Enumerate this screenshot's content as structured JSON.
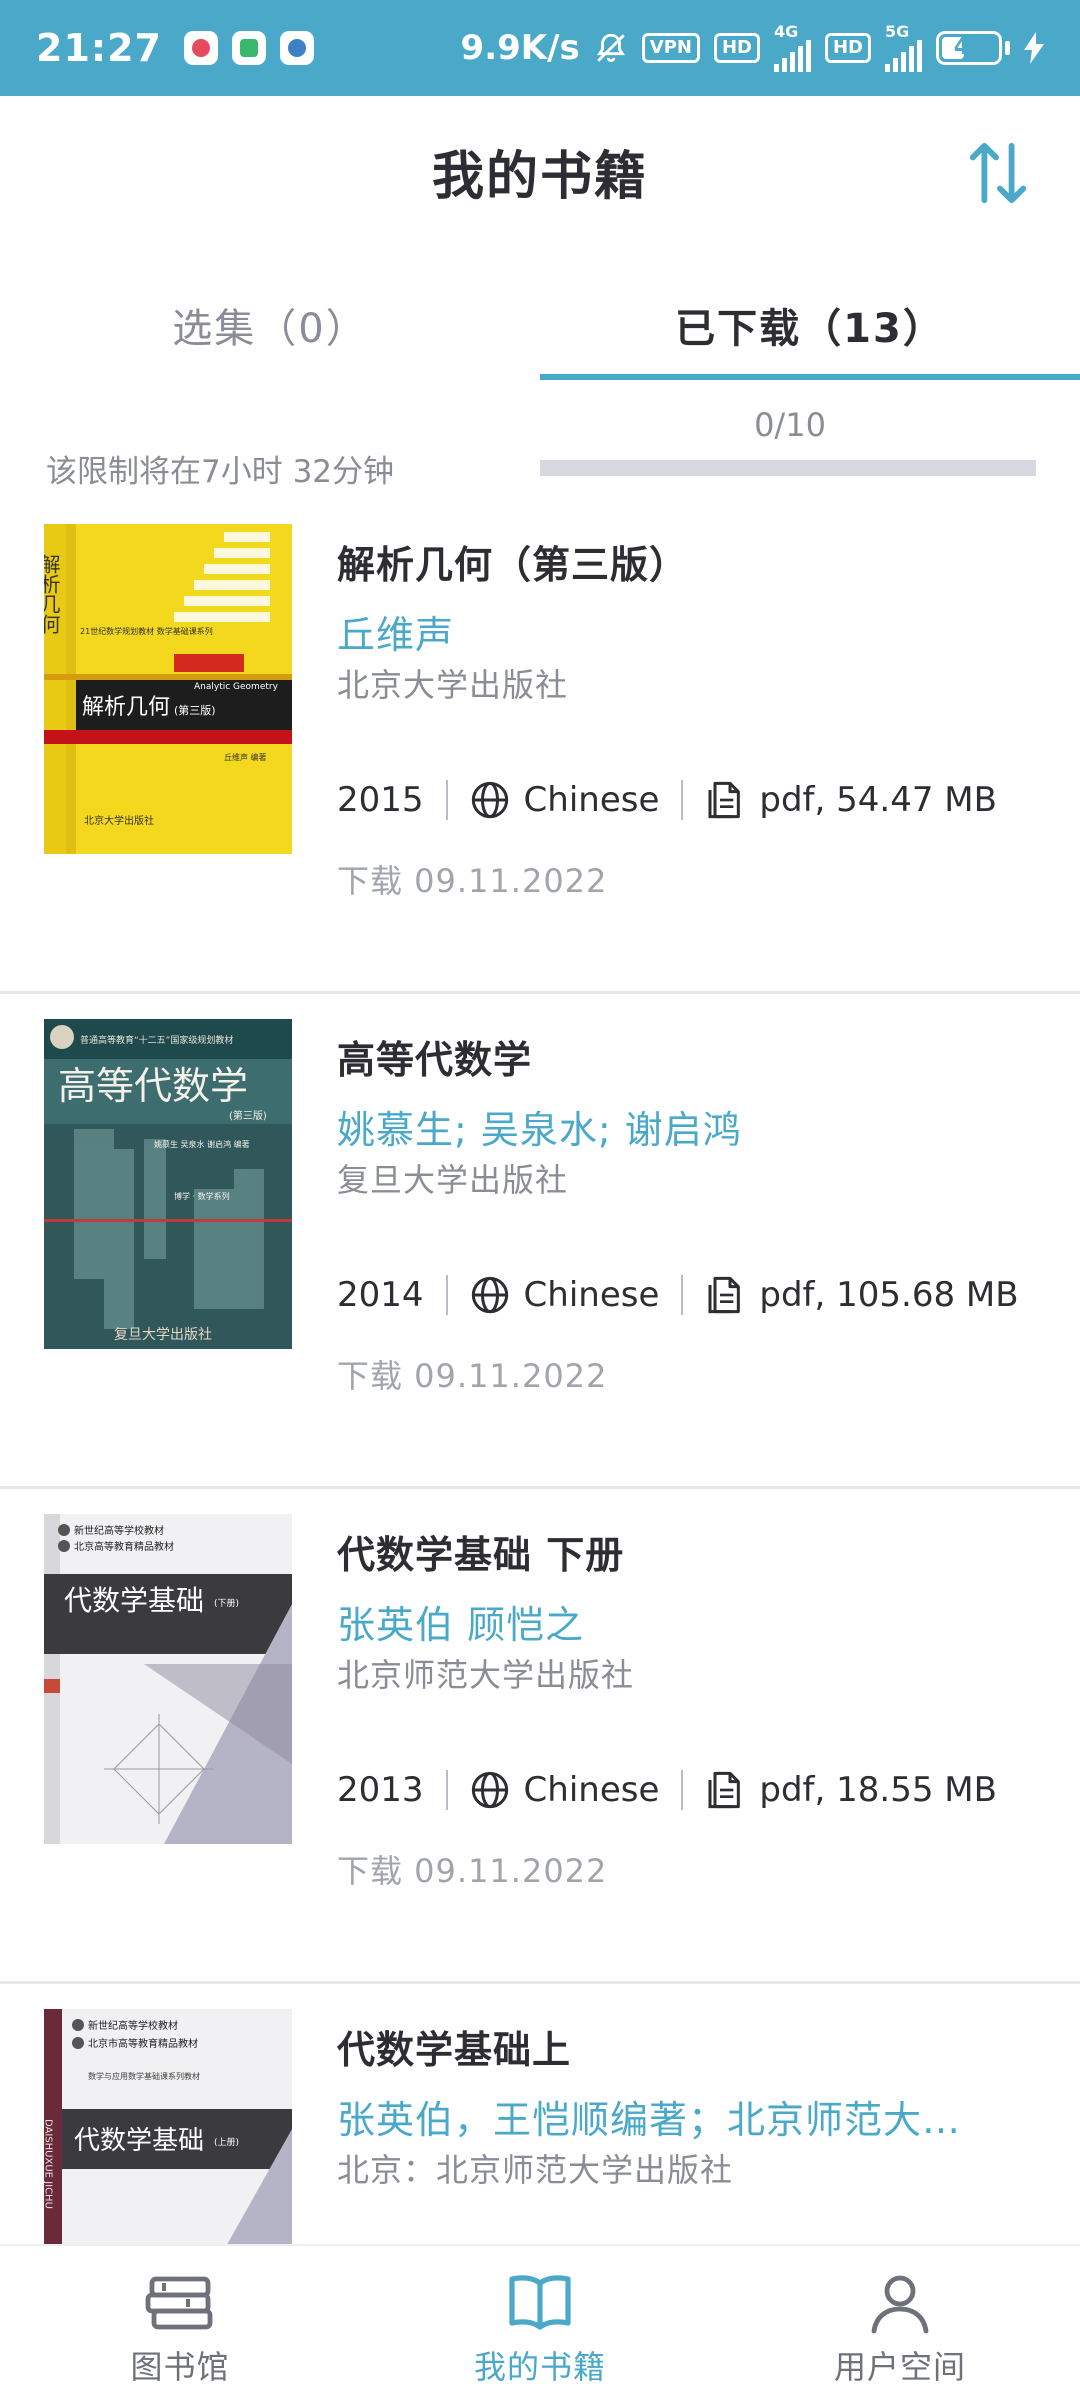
{
  "status_bar": {
    "time": "21:27",
    "speed": "9.9K/s",
    "vpn": "VPN",
    "hd": "HD",
    "net_4g": "4G",
    "net_5g": "5G",
    "battery": "40"
  },
  "header": {
    "title": "我的书籍",
    "sort_icon": "sort-arrows-icon"
  },
  "tabs": [
    {
      "label": "选集（0）",
      "active": false
    },
    {
      "label": "已下载（13）",
      "active": true
    }
  ],
  "quota": {
    "reset_text": "该限制将在7小时 32分钟",
    "count": "0/10",
    "used_fraction": 0
  },
  "books": [
    {
      "title": "解析几何（第三版）",
      "author": "丘维声",
      "publisher": "北京大学出版社",
      "year": "2015",
      "language": "Chinese",
      "file": "pdf, 54.47 MB",
      "downloaded": "下载 09.11.2022",
      "cover": {
        "title": "解析几何",
        "edition": "(第三版)",
        "subtitle": "Analytic Geometry",
        "author": "丘维声 编著",
        "publisher": "北京大学出版社",
        "series": "21世纪数学规划教材 数学基础课系列"
      }
    },
    {
      "title": "高等代数学",
      "author": "姚慕生; 吴泉水; 谢启鸿",
      "publisher": "复旦大学出版社",
      "year": "2014",
      "language": "Chinese",
      "file": "pdf, 105.68 MB",
      "downloaded": "下载 09.11.2022",
      "cover": {
        "title": "高等代数学",
        "edition": "(第三版)",
        "author": "姚慕生 吴泉水 谢启鸿 编著",
        "header": "普通高等教育“十二五”国家级规划教材",
        "series": "博学 · 数学系列",
        "publisher": "复旦大学出版社"
      }
    },
    {
      "title": "代数学基础 下册",
      "author": "张英伯 顾恺之",
      "publisher": "北京师范大学出版社",
      "year": "2013",
      "language": "Chinese",
      "file": "pdf, 18.55 MB",
      "downloaded": "下载 09.11.2022",
      "cover": {
        "title": "代数学基础",
        "edition": "(下册)",
        "line1": "新世纪高等学校教材",
        "line2": "北京高等教育精品教材"
      }
    },
    {
      "title": "代数学基础上",
      "author": "张英伯，王恺顺编著；北京师范大学出版社",
      "publisher": "北京：北京师范大学出版社",
      "year": "",
      "language": "",
      "file": "",
      "downloaded": "",
      "cover": {
        "title": "代数学基础",
        "edition": "(上册)",
        "line1": "新世纪高等学校教材",
        "line2": "北京市高等教育精品教材",
        "line3": "数学与应用数学基础课系列教材",
        "spine": "DAISHUXUE JICHU"
      }
    }
  ],
  "bottom_nav": [
    {
      "label": "图书馆",
      "icon": "library-icon",
      "active": false
    },
    {
      "label": "我的书籍",
      "icon": "open-book-icon",
      "active": true
    },
    {
      "label": "用户空间",
      "icon": "user-icon",
      "active": false
    }
  ],
  "colors": {
    "accent": "#4aa9c8",
    "text_dark": "#2d2d33",
    "text_muted": "#8a8d96",
    "status_bar": "#4aa9c8"
  }
}
